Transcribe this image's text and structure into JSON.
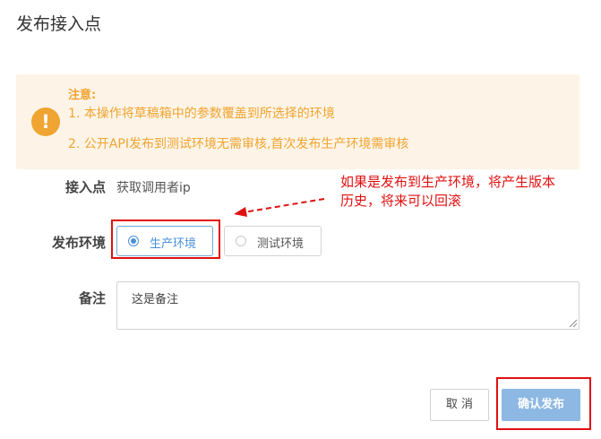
{
  "dialog": {
    "title": "发布接入点"
  },
  "notice": {
    "heading": "注意:",
    "icon": "exclamation-icon",
    "lines": [
      "1. 本操作将草稿箱中的参数覆盖到所选择的环境",
      "2. 公开API发布到测试环境无需审核,首次发布生产环境需审核"
    ],
    "color": "#f0a431",
    "background": "#fdf4e7"
  },
  "form": {
    "endpoint_label": "接入点",
    "endpoint_value": "获取调用者ip",
    "env_label": "发布环境",
    "env_options": [
      {
        "label": "生产环境",
        "selected": true
      },
      {
        "label": "测试环境",
        "selected": false
      }
    ],
    "remark_label": "备注",
    "remark_value": "这是备注"
  },
  "annotation": {
    "text": "如果是发布到生产环境，将产生版本历史，将来可以回滚",
    "color": "#e01010"
  },
  "buttons": {
    "cancel": "取 消",
    "confirm": "确认发布"
  },
  "colors": {
    "accent": "#4a90d9",
    "confirm_bg": "#8cb8e3",
    "highlight": "#e01010"
  }
}
